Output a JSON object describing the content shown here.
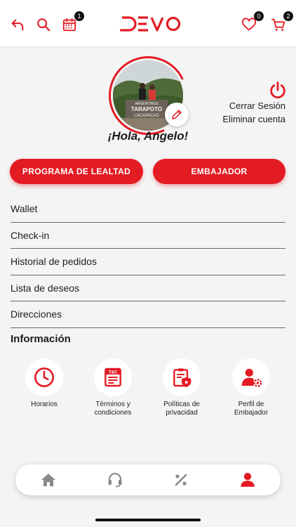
{
  "colors": {
    "brand_red": "#e31b23",
    "dark": "#1c1c1c",
    "nav_gray": "#8a8a8a"
  },
  "header": {
    "brand": "DEVO",
    "back_icon": "back-arrow-icon",
    "search_icon": "search-icon",
    "calendar_icon": "calendar-icon",
    "calendar_badge": "1",
    "wishlist_badge": "0",
    "cart_badge": "2"
  },
  "profile": {
    "greeting": "¡Hola, Angelo!",
    "logout_label": "Cerrar Sesión",
    "delete_label": "Eliminar cuenta",
    "avatar_sign_top": "ARGENTINOS",
    "avatar_sign_mid": "TARAPOTO",
    "avatar_sign_bot": "LACAPACAS"
  },
  "buttons": {
    "loyalty": "PROGRAMA DE LEALTAD",
    "ambassador": "EMBAJADOR"
  },
  "menu": [
    {
      "label": "Wallet"
    },
    {
      "label": "Check-in"
    },
    {
      "label": "Historial de pedidos"
    },
    {
      "label": "Lista de deseos"
    },
    {
      "label": "Direcciones"
    }
  ],
  "info": {
    "title": "Información",
    "tiles": [
      {
        "line1": "Horarios",
        "line2": "",
        "icon": "clock-icon"
      },
      {
        "line1": "Términos y",
        "line2": "condiciones",
        "icon": "terms-document-icon"
      },
      {
        "line1": "Políticas de",
        "line2": "privacidad",
        "icon": "privacy-shield-icon"
      },
      {
        "line1": "Perfil de",
        "line2": "Embajador",
        "icon": "ambassador-profile-icon"
      }
    ],
    "terms_badge": "T&C"
  },
  "bottom_nav": [
    {
      "name": "home",
      "icon": "home-icon",
      "active": false
    },
    {
      "name": "support",
      "icon": "headset-icon",
      "active": false
    },
    {
      "name": "promotions",
      "icon": "percent-icon",
      "active": false
    },
    {
      "name": "profile",
      "icon": "user-icon",
      "active": true
    }
  ]
}
